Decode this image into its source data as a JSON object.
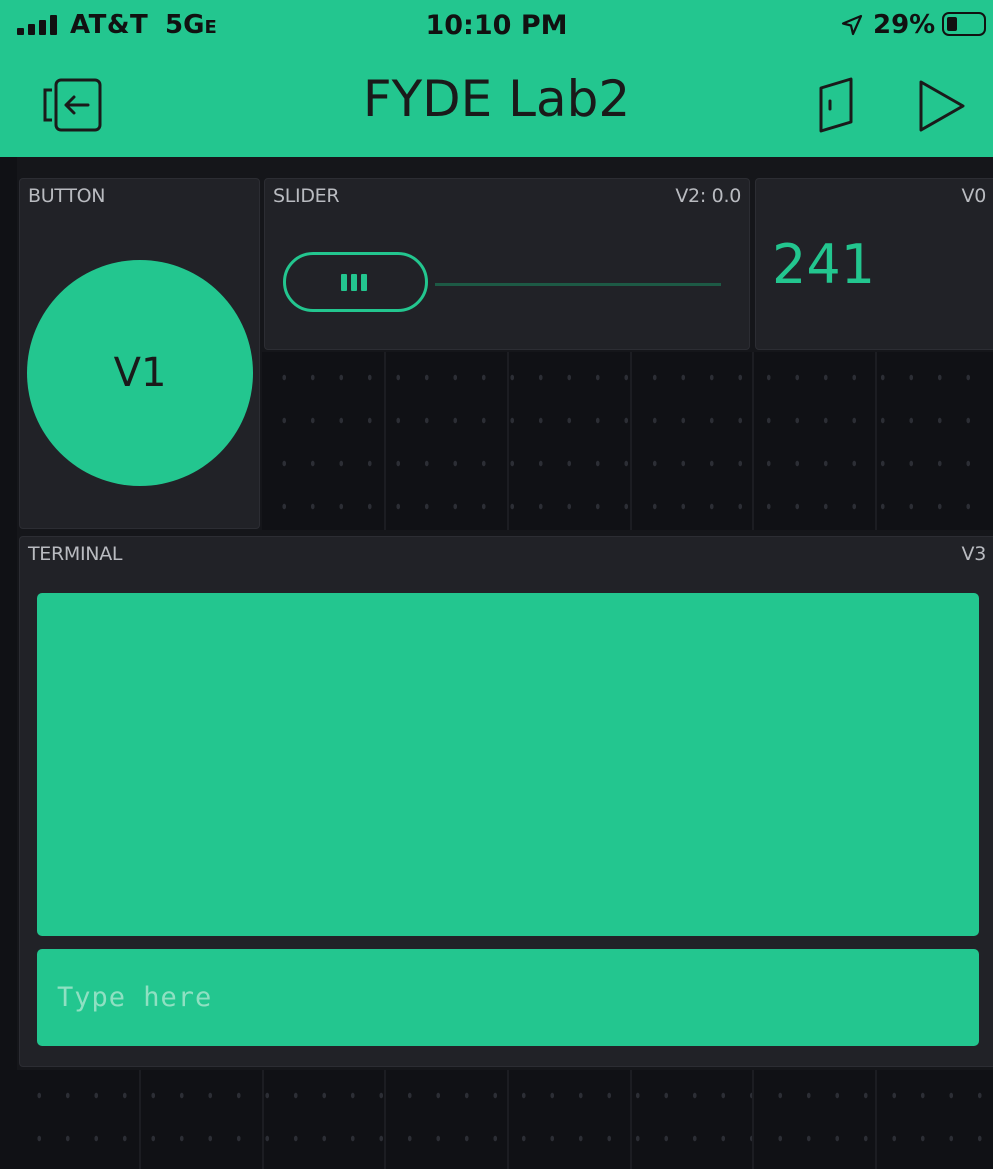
{
  "status_bar": {
    "carrier": "AT&T",
    "network": "5G",
    "network_suffix": "E",
    "time": "10:10 PM",
    "battery_percent": "29%",
    "battery_level": 0.29
  },
  "header": {
    "title": "FYDE Lab2",
    "back_icon": "exit-project-icon",
    "device_icon": "door-icon",
    "play_icon": "play-icon"
  },
  "widgets": {
    "button": {
      "label": "BUTTON",
      "pin_label": "V1"
    },
    "slider": {
      "label": "SLIDER",
      "pin_value": "V2: 0.0",
      "value": 0
    },
    "value_display": {
      "pin": "V0",
      "value": "241"
    },
    "terminal": {
      "label": "TERMINAL",
      "pin": "V3",
      "input_placeholder": "Type here"
    }
  },
  "colors": {
    "accent": "#23c68f",
    "background": "#101115",
    "widget_bg": "#212227",
    "label": "#b9bbc0"
  }
}
